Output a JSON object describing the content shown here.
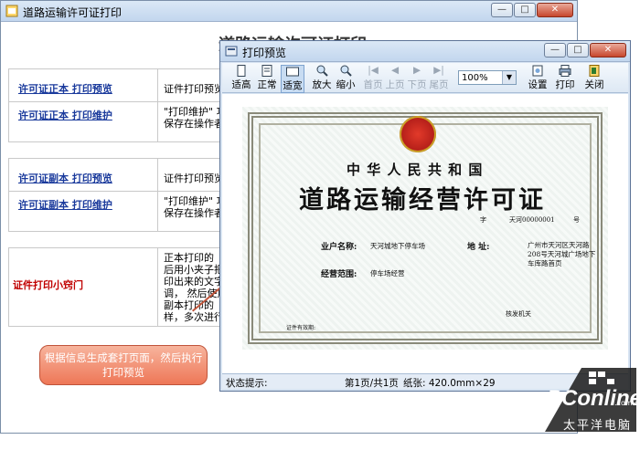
{
  "main_window": {
    "title": "道路运输许可证打印",
    "heading": "道路运输许可证打印",
    "rows": [
      {
        "label": "许可证正本  打印预览",
        "text": "证件打印预览功"
      },
      {
        "label": "许可证正本  打印维护",
        "text": "\"打印维护\" 功能\n保存在操作者的"
      },
      {
        "label": "许可证副本  打印预览",
        "text": "证件打印预览功"
      },
      {
        "label": "许可证副本  打印维护",
        "text": "\"打印维护\" 功能\n保存在操作者的"
      },
      {
        "label": "证件打印小窍门",
        "text": "正本打印的\n后用小夹子把打\n印出来的文字位\n调，  然后使用\n副本打印的\n样，多次进行打"
      }
    ]
  },
  "preview_window": {
    "title": "打印预览",
    "toolbar": [
      {
        "label": "适高",
        "icon": "fit-height-icon",
        "state": "normal"
      },
      {
        "label": "正常",
        "icon": "page-normal-icon",
        "state": "normal"
      },
      {
        "label": "适宽",
        "icon": "fit-width-icon",
        "state": "selected"
      },
      {
        "label": "放大",
        "icon": "zoom-in-icon",
        "state": "normal"
      },
      {
        "label": "缩小",
        "icon": "zoom-out-icon",
        "state": "normal"
      },
      {
        "label": "首页",
        "icon": "first-page-icon",
        "state": "disabled"
      },
      {
        "label": "上页",
        "icon": "prev-page-icon",
        "state": "disabled"
      },
      {
        "label": "下页",
        "icon": "next-page-icon",
        "state": "disabled"
      },
      {
        "label": "尾页",
        "icon": "last-page-icon",
        "state": "disabled"
      },
      {
        "label": "设置",
        "icon": "settings-icon",
        "state": "normal"
      },
      {
        "label": "打印",
        "icon": "printer-icon",
        "state": "normal"
      },
      {
        "label": "关闭",
        "icon": "close-door-icon",
        "state": "normal"
      }
    ],
    "zoom": "100%",
    "status": {
      "label": "状态提示:",
      "page": "第1页/共1页",
      "paper": "纸张: 420.0mm×29"
    }
  },
  "certificate": {
    "country": "中 华 人 民 共 和 国",
    "title": "道路运输经营许可证",
    "number_prefix": "字",
    "number": "天河00000001",
    "number_suffix": "号",
    "owner_label": "业户名称:",
    "owner_value": "天河城地下停车场",
    "address_label": "地        址:",
    "address_value": "广州市天河区天河路\n208号天河城广场地下\n车库路首页",
    "scope_label": "经营范围:",
    "scope_value": "停车场经营",
    "issuer": "核发机关",
    "validity_label": "证件有效期:"
  },
  "callout": {
    "text": "根据信息生成套打页面，然后执行打印预览"
  },
  "watermark": {
    "brand": "PConline",
    "domain": ".com.cn",
    "slogan": "太平洋电脑网"
  },
  "colors": {
    "link": "#1a3a9c",
    "accent_red": "#c00000",
    "callout": "#ee7757"
  }
}
